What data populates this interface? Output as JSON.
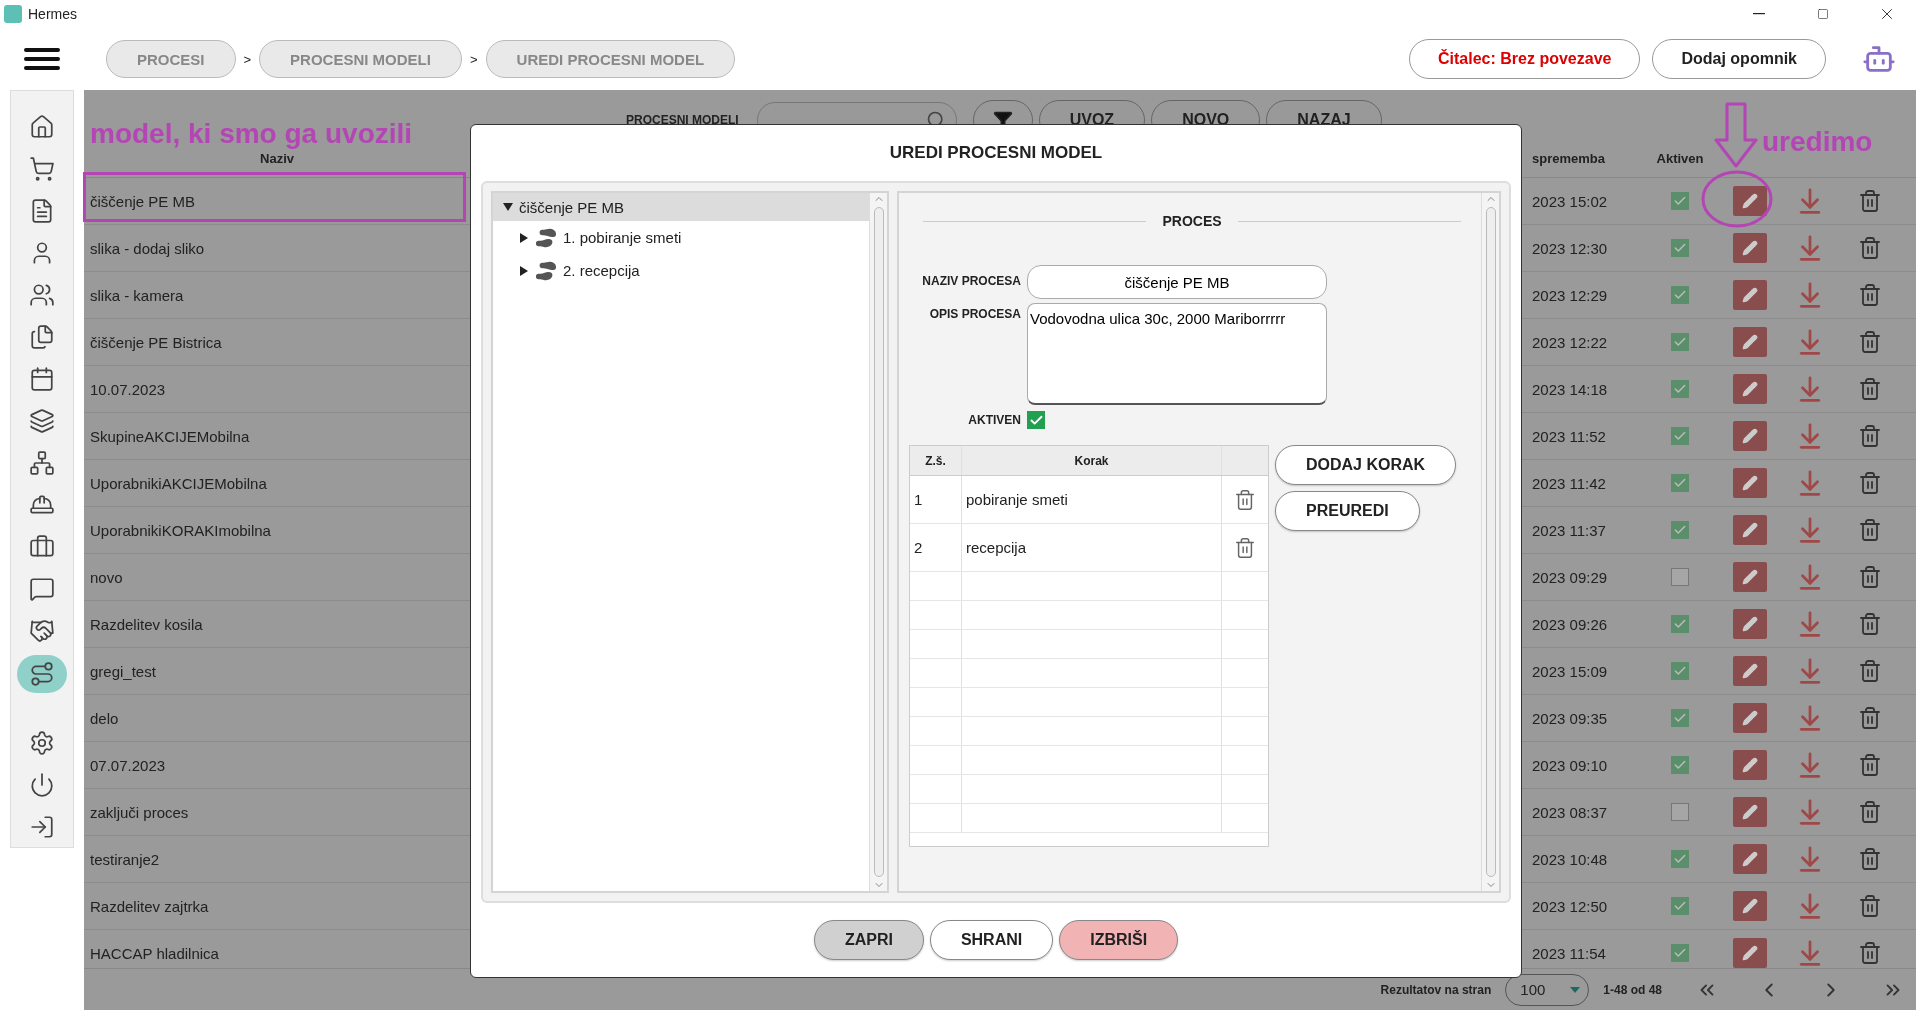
{
  "window": {
    "title": "Hermes"
  },
  "breadcrumbs": {
    "separator": ">",
    "items": [
      {
        "label": "PROCESI"
      },
      {
        "label": "PROCESNI MODELI"
      },
      {
        "label": "UREDI PROCESNI MODEL"
      }
    ]
  },
  "reader_status": "Čitalec: Brez povezave",
  "reminder_button": "Dodaj opomnik",
  "sidebar": {
    "items": [
      {
        "selected": false
      },
      {
        "selected": false
      },
      {
        "selected": false
      },
      {
        "selected": false
      },
      {
        "selected": false
      },
      {
        "selected": false
      },
      {
        "selected": false
      },
      {
        "selected": false
      },
      {
        "selected": false
      },
      {
        "selected": false
      },
      {
        "selected": false
      },
      {
        "selected": false
      },
      {
        "selected": false
      },
      {
        "selected": true
      }
    ],
    "bottom_items": [
      {
        "selected": false
      },
      {
        "selected": false
      },
      {
        "selected": false
      }
    ]
  },
  "toolbar": {
    "label": "PROCESNI MODELI",
    "buttons": [
      "UVOZ",
      "NOVO",
      "NAZAJ"
    ]
  },
  "table": {
    "columns": [
      "Naziv",
      "sprememba",
      "Aktiven"
    ],
    "rows": [
      {
        "name": "čiščenje PE MB",
        "modified": "2023 15:02",
        "active": true
      },
      {
        "name": "slika - dodaj sliko",
        "modified": "2023 12:30",
        "active": true
      },
      {
        "name": "slika - kamera",
        "modified": "2023 12:29",
        "active": true
      },
      {
        "name": "čiščenje PE Bistrica",
        "modified": "2023 12:22",
        "active": true
      },
      {
        "name": "10.07.2023",
        "modified": "2023 14:18",
        "active": true
      },
      {
        "name": "SkupineAKCIJEMobilna",
        "modified": "2023 11:52",
        "active": true
      },
      {
        "name": "UporabnikiAKCIJEMobilna",
        "modified": "2023 11:42",
        "active": true
      },
      {
        "name": "UporabnikiKORAKImobilna",
        "modified": "2023 11:37",
        "active": true
      },
      {
        "name": "novo",
        "modified": "2023 09:29",
        "active": false
      },
      {
        "name": "Razdelitev kosila",
        "modified": "2023 09:26",
        "active": true
      },
      {
        "name": "gregi_test",
        "modified": "2023 15:09",
        "active": true
      },
      {
        "name": "delo",
        "modified": "2023 09:35",
        "active": true
      },
      {
        "name": "07.07.2023",
        "modified": "2023 09:10",
        "active": true
      },
      {
        "name": "zaključi proces",
        "modified": "2023 08:37",
        "active": false
      },
      {
        "name": "testiranje2",
        "modified": "2023 10:48",
        "active": true
      },
      {
        "name": "Razdelitev zajtrka",
        "modified": "2023 12:50",
        "active": true
      },
      {
        "name": "HACCAP hladilnica",
        "modified": "2023 11:54",
        "active": true
      }
    ]
  },
  "pagination": {
    "label": "Rezultatov na stran",
    "page_size": "100",
    "range": "1-48 od 48"
  },
  "dialog": {
    "title": "UREDI PROCESNI MODEL",
    "tree": {
      "label": "čiščenje PE MB",
      "expanded": true,
      "selected": true,
      "children": [
        {
          "label": "1. pobiranje smeti",
          "expanded": false,
          "selected": false
        },
        {
          "label": "2. recepcija",
          "expanded": false,
          "selected": false
        }
      ]
    },
    "section": "PROCES",
    "name_label": "NAZIV PROCESA",
    "name": "čiščenje PE MB",
    "description_label": "OPIS PROCESA",
    "description": "Vodovodna ulica 30c, 2000 Mariborrrrr",
    "active_label": "AKTIVEN",
    "active": true,
    "steps": {
      "columns": [
        "Z.š.",
        "Korak"
      ],
      "rows": [
        {
          "number": "1",
          "name": "pobiranje smeti"
        },
        {
          "number": "2",
          "name": "recepcija"
        }
      ]
    },
    "step_buttons": [
      "DODAJ KORAK",
      "PREUREDI"
    ],
    "buttons": [
      {
        "label": "ZAPRI",
        "kind": "neutral"
      },
      {
        "label": "SHRANI",
        "kind": "plain"
      },
      {
        "label": "IZBRIŠI",
        "kind": "danger"
      }
    ]
  },
  "annotations": {
    "imported": "model, ki smo ga uvozili",
    "edit": "uredimo"
  }
}
